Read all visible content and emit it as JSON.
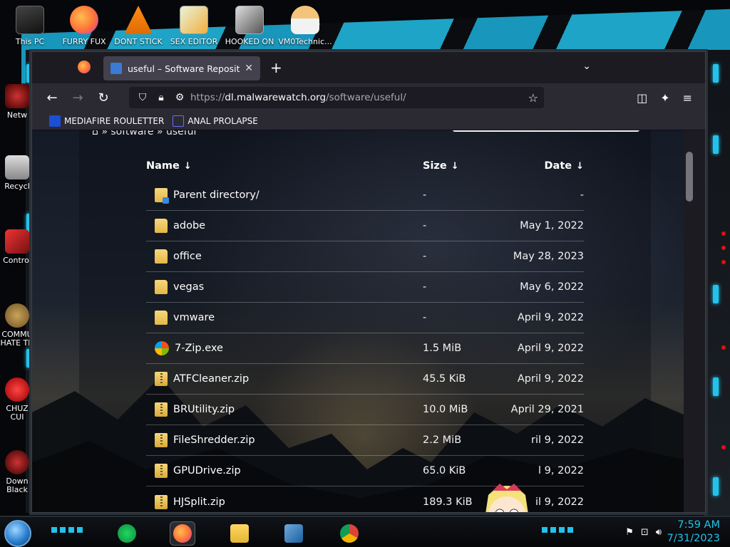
{
  "desktop": {
    "top_icons": [
      {
        "label": "This PC",
        "icon": "computer-icon"
      },
      {
        "label": "FURRY FUX",
        "icon": "firefox-icon"
      },
      {
        "label": "DONT STICK",
        "icon": "vlc-icon"
      },
      {
        "label": "SEX EDITOR",
        "icon": "hxd-icon"
      },
      {
        "label": "HOOKED ON",
        "icon": "hooked-icon"
      },
      {
        "label": "VM0Technic...",
        "icon": "doctor-icon"
      }
    ],
    "left_icons": [
      {
        "label": "Netw",
        "icon": "network-icon"
      },
      {
        "label": "Recycl",
        "icon": "recycle-bin-icon"
      },
      {
        "label": "Control",
        "icon": "control-panel-icon"
      },
      {
        "label": "COMMU HATE TH",
        "icon": "money-bag-icon"
      },
      {
        "label": "CHUZ CUI",
        "icon": "red-creature-icon"
      },
      {
        "label": "Down Black",
        "icon": "download-icon"
      }
    ]
  },
  "browser": {
    "tab_title": "useful – Software Repository",
    "url_prefix": "https://",
    "url_host": "dl.malwarewatch.org",
    "url_path": "/software/useful/",
    "bookmarks": [
      {
        "label": "MEDIAFIRE ROULETTER",
        "icon": "mediafire-icon"
      },
      {
        "label": "ANAL PROLAPSE",
        "icon": "sigma-icon"
      }
    ]
  },
  "page": {
    "breadcrumb": "» software » useful",
    "headers": {
      "name": "Name",
      "size": "Size",
      "date": "Date"
    },
    "rows": [
      {
        "name": "Parent directory/",
        "size": "-",
        "date": "-",
        "type": "parent"
      },
      {
        "name": "adobe",
        "size": "-",
        "date": "May 1, 2022",
        "type": "folder"
      },
      {
        "name": "office",
        "size": "-",
        "date": "May 28, 2023",
        "type": "folder"
      },
      {
        "name": "vegas",
        "size": "-",
        "date": "May 6, 2022",
        "type": "folder"
      },
      {
        "name": "vmware",
        "size": "-",
        "date": "April 9, 2022",
        "type": "folder"
      },
      {
        "name": "7-Zip.exe",
        "size": "1.5 MiB",
        "date": "April 9, 2022",
        "type": "exe"
      },
      {
        "name": "ATFCleaner.zip",
        "size": "45.5 KiB",
        "date": "April 9, 2022",
        "type": "zip"
      },
      {
        "name": "BRUtility.zip",
        "size": "10.0 MiB",
        "date": "April 29, 2021",
        "type": "zip"
      },
      {
        "name": "FileShredder.zip",
        "size": "2.2 MiB",
        "date": "ril 9, 2022",
        "type": "zip"
      },
      {
        "name": "GPUDrive.zip",
        "size": "65.0 KiB",
        "date": "l 9, 2022",
        "type": "zip"
      },
      {
        "name": "HJSplit.zip",
        "size": "189.3 KiB",
        "date": "il 9, 2022",
        "type": "zip"
      }
    ]
  },
  "taskbar": {
    "apps": [
      {
        "icon": "spotify-icon"
      },
      {
        "icon": "firefox-icon",
        "active": true
      },
      {
        "icon": "file-explorer-icon"
      },
      {
        "icon": "virtualbox-icon"
      },
      {
        "icon": "chrome-icon"
      }
    ],
    "time": "7:59 AM",
    "date": "7/31/2023"
  },
  "colors": {
    "accent": "#23c2ea",
    "browser_bg": "#1c1b22",
    "toolbar_bg": "#2b2a33"
  }
}
